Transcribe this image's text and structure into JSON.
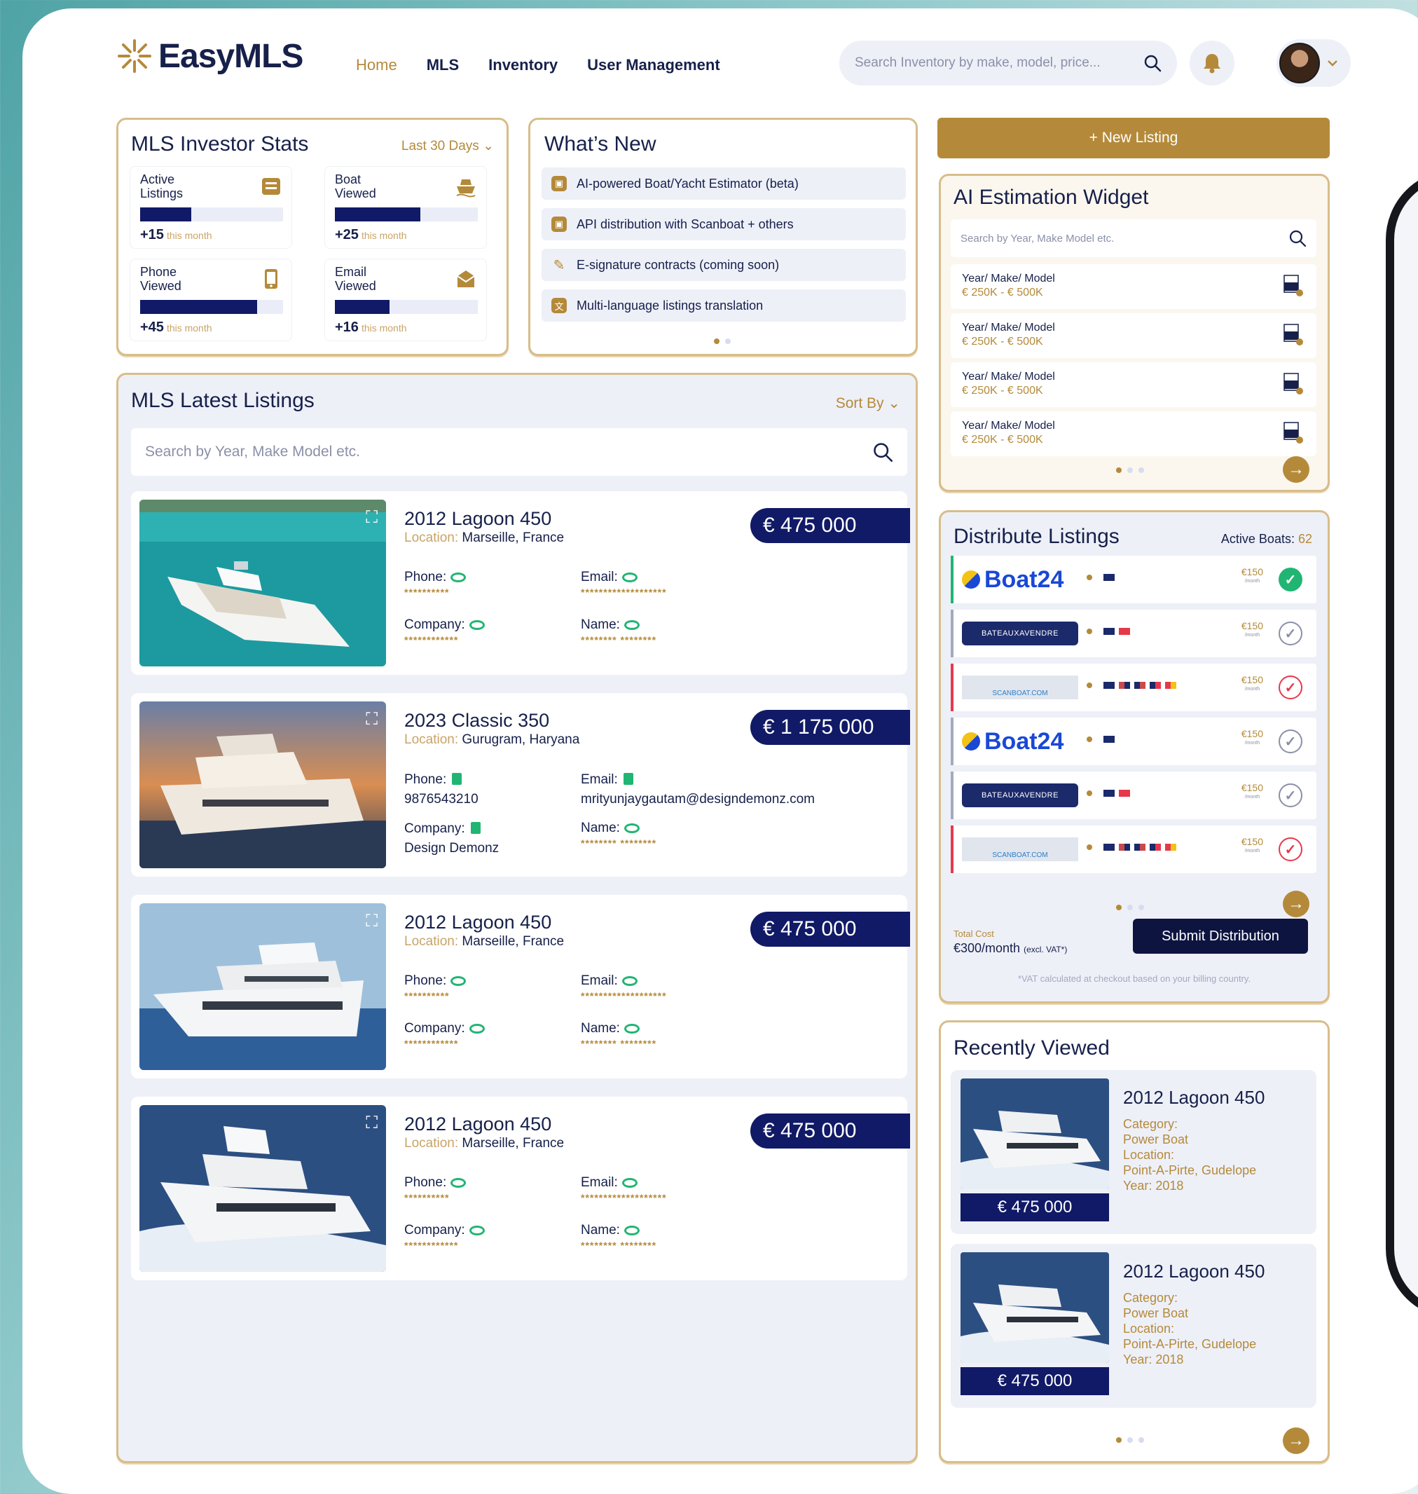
{
  "app": {
    "name": "EasyMLS"
  },
  "nav": [
    {
      "label": "Home",
      "active": true
    },
    {
      "label": "MLS"
    },
    {
      "label": "Inventory"
    },
    {
      "label": "User Management"
    }
  ],
  "search": {
    "placeholder": "Search Inventory by make, model, price..."
  },
  "stats": {
    "title": "MLS Investor Stats",
    "range": "Last 30 Days",
    "items": [
      {
        "label_1": "Active",
        "label_2": "Listings",
        "delta": "+15",
        "note": "this month",
        "fill": 0.36,
        "icon": "listings-icon"
      },
      {
        "label_1": "Boat",
        "label_2": "Viewed",
        "delta": "+25",
        "note": "this month",
        "fill": 0.6,
        "icon": "boat-icon"
      },
      {
        "label_1": "Phone",
        "label_2": "Viewed",
        "delta": "+45",
        "note": "this month",
        "fill": 0.82,
        "icon": "phone-icon"
      },
      {
        "label_1": "Email",
        "label_2": "Viewed",
        "delta": "+16",
        "note": "this month",
        "fill": 0.38,
        "icon": "email-icon"
      }
    ]
  },
  "whats_new": {
    "title": "What’s New",
    "items": [
      "AI-powered Boat/Yacht Estimator (beta)",
      "API distribution with Scanboat + others",
      "E-signature contracts (coming soon)",
      "Multi-language listings translation"
    ]
  },
  "new_listing_label": "+ New Listing",
  "listings": {
    "title": "MLS Latest Listings",
    "sort_label": "Sort By",
    "search_placeholder": "Search by Year, Make Model etc.",
    "items": [
      {
        "name": "2012 Lagoon 450",
        "location_label": "Location:",
        "location": "Marseille, France",
        "price": "€ 475 000",
        "phone_label": "Phone:",
        "phone": "**********",
        "email_label": "Email:",
        "email": "*******************",
        "company_label": "Company:",
        "company": "************",
        "name_label": "Name:",
        "contact_name": "******** ********"
      },
      {
        "name": "2023 Classic 350",
        "location_label": "Location:",
        "location": "Gurugram, Haryana",
        "price": "€ 1 175 000",
        "phone_label": "Phone:",
        "phone": "9876543210",
        "email_label": "Email:",
        "email": "mrityunjaygautam@designdemonz.com",
        "company_label": "Company:",
        "company": "Design Demonz",
        "name_label": "Name:",
        "contact_name": "******** ********"
      },
      {
        "name": "2012 Lagoon 450",
        "location_label": "Location:",
        "location": "Marseille, France",
        "price": "€ 475 000",
        "phone_label": "Phone:",
        "phone": "**********",
        "email_label": "Email:",
        "email": "*******************",
        "company_label": "Company:",
        "company": "************",
        "name_label": "Name:",
        "contact_name": "******** ********"
      },
      {
        "name": "2012 Lagoon 450",
        "location_label": "Location:",
        "location": "Marseille, France",
        "price": "€ 475 000",
        "phone_label": "Phone:",
        "phone": "**********",
        "email_label": "Email:",
        "email": "*******************",
        "company_label": "Company:",
        "company": "************",
        "name_label": "Name:",
        "contact_name": "******** ********"
      }
    ]
  },
  "ai_widget": {
    "title": "AI Estimation Widget",
    "search_placeholder": "Search by Year, Make Model etc.",
    "rows": [
      {
        "line1": "Year/ Make/ Model",
        "line2": "€ 250K - € 500K"
      },
      {
        "line1": "Year/ Make/ Model",
        "line2": "€ 250K - € 500K"
      },
      {
        "line1": "Year/ Make/ Model",
        "line2": "€ 250K - € 500K"
      },
      {
        "line1": "Year/ Make/ Model",
        "line2": "€ 250K - € 500K"
      }
    ]
  },
  "distribute": {
    "title": "Distribute Listings",
    "active_label": "Active Boats:",
    "active_count": "62",
    "rows": [
      {
        "brand": "Boat24",
        "type": "boat24",
        "fee": "€150",
        "fee_unit": "/month",
        "status": "ok"
      },
      {
        "brand": "BATEAUXAVENDRE",
        "type": "bateau",
        "fee": "€150",
        "fee_unit": "/month",
        "status": "off"
      },
      {
        "brand": "SCANBOAT.COM",
        "type": "scanboat",
        "fee": "€150",
        "fee_unit": "/month",
        "status": "bad"
      },
      {
        "brand": "Boat24",
        "type": "boat24",
        "fee": "€150",
        "fee_unit": "/month",
        "status": "off"
      },
      {
        "brand": "BATEAUXAVENDRE",
        "type": "bateau",
        "fee": "€150",
        "fee_unit": "/month",
        "status": "off"
      },
      {
        "brand": "SCANBOAT.COM",
        "type": "scanboat",
        "fee": "€150",
        "fee_unit": "/month",
        "status": "bad"
      }
    ],
    "total_label": "Total Cost",
    "total_value": "€300/month",
    "total_note": "(excl. VAT*)",
    "submit_label": "Submit Distribution",
    "vat_note": "*VAT calculated at checkout based on your billing country."
  },
  "recent": {
    "title": "Recently Viewed",
    "items": [
      {
        "name": "2012 Lagoon 450",
        "price": "€ 475 000",
        "cat_label": "Category:",
        "category": "Power Boat",
        "loc_label": "Location:",
        "location": "Point-A-Pirte, Gudelope",
        "year": "Year: 2018"
      },
      {
        "name": "2012 Lagoon 450",
        "price": "€ 475 000",
        "cat_label": "Category:",
        "category": "Power Boat",
        "loc_label": "Location:",
        "location": "Point-A-Pirte, Gudelope",
        "year": "Year: 2018"
      }
    ]
  },
  "colors": {
    "navy": "#111a66",
    "gold": "#b48a3a",
    "green": "#21b573",
    "red": "#e5394b"
  }
}
